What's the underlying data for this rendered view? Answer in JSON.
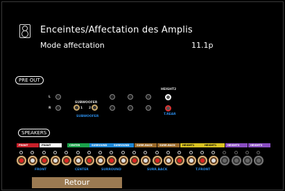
{
  "header": {
    "title": "Enceintes/Affectation des Amplis"
  },
  "mode": {
    "label": "Mode affectation",
    "value": "11.1p"
  },
  "pre_out": {
    "section_label": "PRE OUT",
    "left_label": "L",
    "right_label": "R",
    "subwoofer_label": "SUBWOOFER",
    "subwoofer_1": "1",
    "subwoofer_2": "2",
    "subwoofer_caption": "SUBWOOFER",
    "height2_label": "HEIGHT2",
    "trear_caption": "T.REAR"
  },
  "speakers": {
    "section_label": "SPEAKERS",
    "tags": [
      {
        "label": "FRONT",
        "color": "#c8202a"
      },
      {
        "label": "FRONT",
        "color": "#ffffff"
      },
      {
        "label": "CENTER",
        "color": "#1aa24a"
      },
      {
        "label": "SURROUND",
        "color": "#1e88d6"
      },
      {
        "label": "SURROUND",
        "color": "#1e88d6"
      },
      {
        "label": "SURR.BACK",
        "color": "#9a6a2a"
      },
      {
        "label": "SURR.BACK",
        "color": "#9a6a2a"
      },
      {
        "label": "HEIGHT1",
        "color": "#d9c323"
      },
      {
        "label": "HEIGHT1",
        "color": "#d9c323"
      },
      {
        "label": "HEIGHT3",
        "color": "#8a4ec2"
      },
      {
        "label": "HEIGHT3",
        "color": "#8a4ec2"
      }
    ],
    "captions": {
      "front": "FRONT",
      "center": "CENTER",
      "surround": "SURROUND",
      "surr_back": "SURR.BACK",
      "t_front": "T.FRONT"
    }
  },
  "footer": {
    "back_button": "Retour"
  }
}
